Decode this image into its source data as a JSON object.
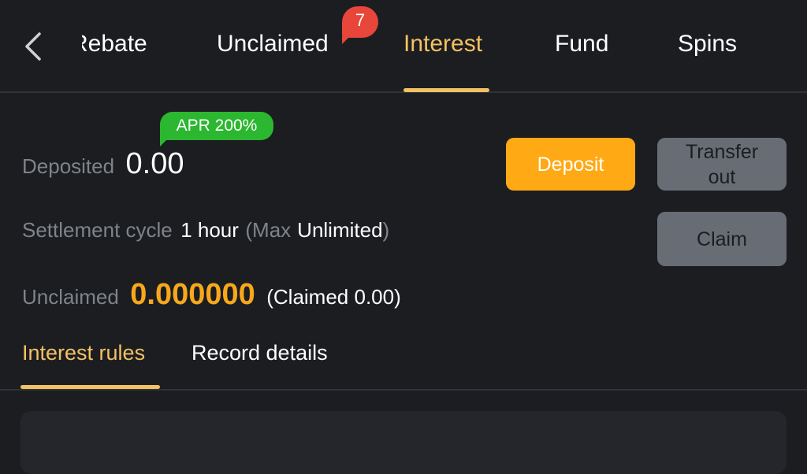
{
  "header": {
    "tabs": [
      {
        "label": "Rebate",
        "active": false
      },
      {
        "label": "Unclaimed",
        "active": false,
        "badge": "7"
      },
      {
        "label": "Interest",
        "active": true
      },
      {
        "label": "Fund",
        "active": false
      },
      {
        "label": "Spins",
        "active": false
      }
    ],
    "back_icon": "chevron-left-icon"
  },
  "interest": {
    "apr_badge": "APR 200%",
    "deposited_label": "Deposited",
    "deposited_value": "0.00",
    "settlement_label": "Settlement cycle",
    "settlement_value": "1 hour",
    "max_open": "(Max",
    "max_value": "Unlimited",
    "max_close": ")",
    "unclaimed_label": "Unclaimed",
    "unclaimed_value": "0.000000",
    "claimed_text": "(Claimed 0.00)"
  },
  "buttons": {
    "deposit": "Deposit",
    "transfer_out_line1": "Transfer",
    "transfer_out_line2": "out",
    "claim": "Claim"
  },
  "subtabs": [
    {
      "label": "Interest rules",
      "active": true
    },
    {
      "label": "Record details",
      "active": false
    }
  ],
  "colors": {
    "background": "#1c1d21",
    "accent_gold": "#f2c162",
    "deposit_orange": "#ffa914",
    "badge_red": "#e8463a",
    "apr_green": "#2bb72f",
    "muted_gray": "#7f838b"
  }
}
